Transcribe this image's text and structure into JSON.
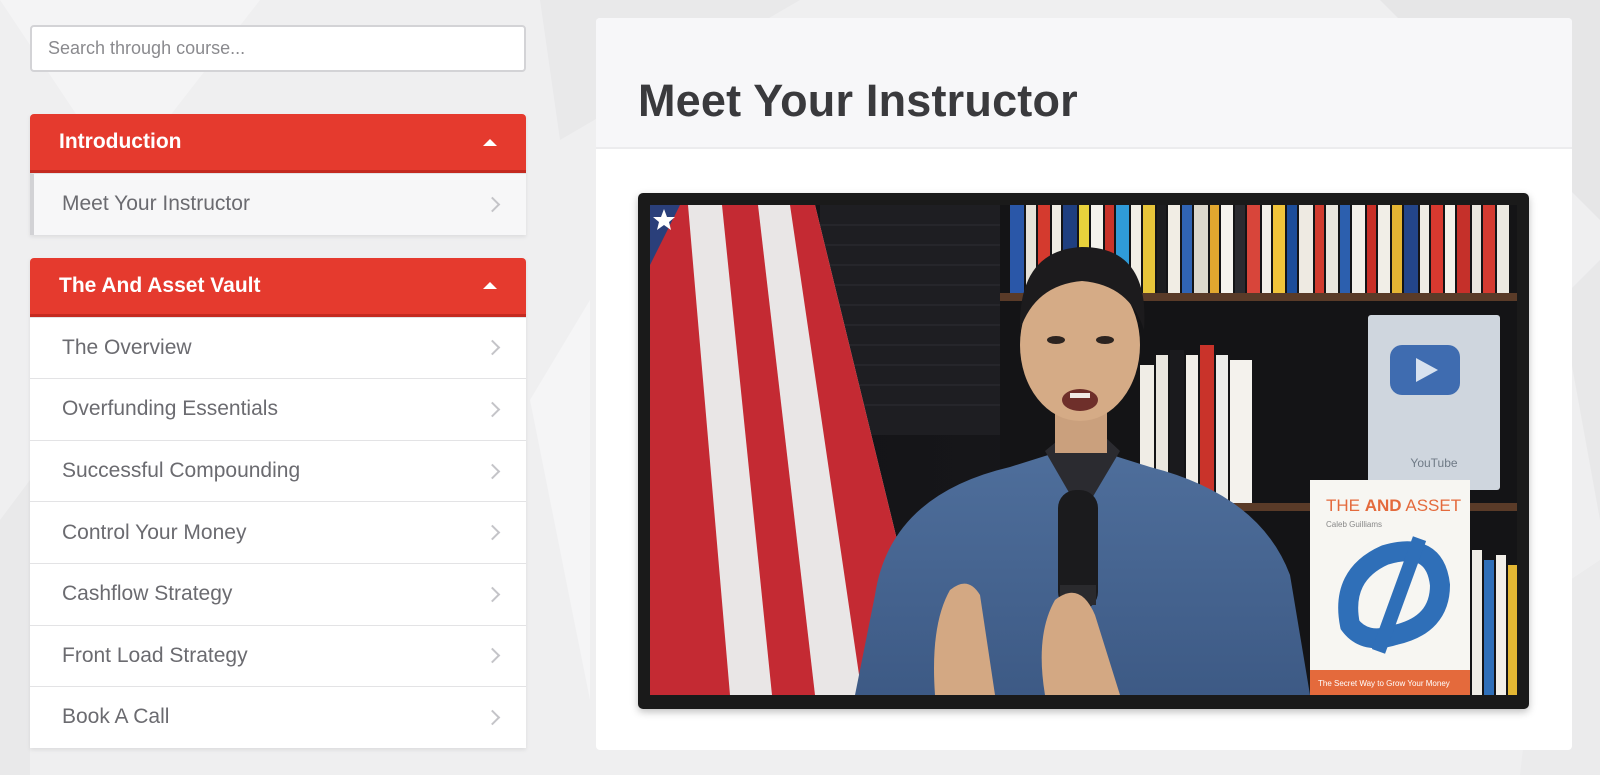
{
  "search": {
    "placeholder": "Search through course..."
  },
  "sidebar": {
    "sections": [
      {
        "title": "Introduction",
        "lessons": [
          {
            "label": "Meet Your Instructor",
            "active": true
          }
        ]
      },
      {
        "title": "The And Asset Vault",
        "lessons": [
          {
            "label": "The Overview"
          },
          {
            "label": "Overfunding Essentials"
          },
          {
            "label": "Successful Compounding"
          },
          {
            "label": "Control Your Money"
          },
          {
            "label": "Cashflow Strategy"
          },
          {
            "label": "Front Load Strategy"
          },
          {
            "label": "Book A Call"
          }
        ]
      }
    ]
  },
  "main": {
    "title": "Meet Your Instructor",
    "video": {
      "book_title_pre": "THE ",
      "book_title_bold": "AND",
      "book_title_post": " ASSET",
      "book_author": "Caleb Guilliams",
      "book_tagline": "The Secret Way to Grow Your Money",
      "plaque_label": "YouTube"
    }
  },
  "colors": {
    "accent": "#e53a2e",
    "accent_dark": "#c42a20",
    "page_bg": "#efeff0",
    "text_muted": "#6b6b70",
    "title_text": "#3a3a3d"
  },
  "icons": {
    "section_toggle": "caret-up-icon",
    "lesson_arrow": "chevron-right-icon"
  }
}
